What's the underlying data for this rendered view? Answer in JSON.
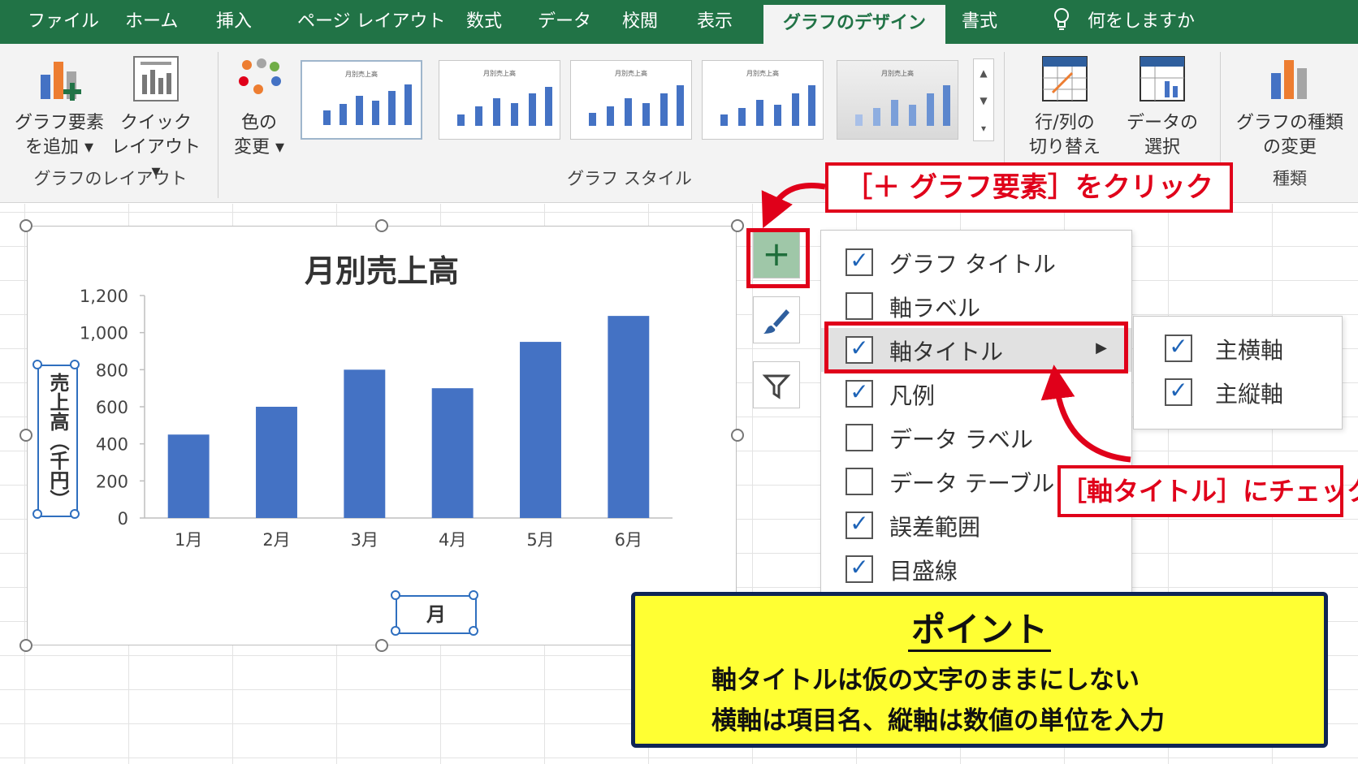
{
  "tabs": [
    {
      "label": "ファイル"
    },
    {
      "label": "ホーム"
    },
    {
      "label": "挿入"
    },
    {
      "label": "ページ レイアウト"
    },
    {
      "label": "数式"
    },
    {
      "label": "データ"
    },
    {
      "label": "校閲"
    },
    {
      "label": "表示"
    },
    {
      "label": "グラフのデザイン"
    },
    {
      "label": "書式"
    }
  ],
  "tell_me": "何をしますか",
  "ribbon": {
    "add_element": {
      "line1": "グラフ要素",
      "line2": "を追加 ▾"
    },
    "quick_layout": {
      "line1": "クイック",
      "line2": "レイアウト ▾"
    },
    "layout_group": "グラフのレイアウト",
    "change_colors": {
      "line1": "色の",
      "line2": "変更 ▾"
    },
    "style_group": "グラフ スタイル",
    "thumb_title": "月別売上高",
    "switch_rowcol": {
      "line1": "行/列の",
      "line2": "切り替え"
    },
    "select_data": {
      "line1": "データの",
      "line2": "選択"
    },
    "change_type": {
      "line1": "グラフの種類",
      "line2": "の変更"
    },
    "type_group": "種類",
    "colors": {
      "accent": "#217346",
      "bar": "#4472c4",
      "highlight": "#e0001a"
    }
  },
  "chart_data": {
    "type": "bar",
    "title": "月別売上高",
    "categories": [
      "1月",
      "2月",
      "3月",
      "4月",
      "5月",
      "6月"
    ],
    "values": [
      450,
      600,
      800,
      700,
      950,
      1090
    ],
    "ylim": [
      0,
      1200
    ],
    "yticks": [
      "0",
      "200",
      "400",
      "600",
      "800",
      "1,000",
      "1,200"
    ],
    "ytick_values": [
      0,
      200,
      400,
      600,
      800,
      1000,
      1200
    ],
    "xlabel": "月",
    "ylabel": "売上高（千円）",
    "grid": false,
    "legend": false,
    "bar_color": "#4472c4"
  },
  "chart_elements_menu": {
    "items": [
      {
        "label": "グラフ タイトル",
        "checked": "✓"
      },
      {
        "label": "軸ラベル",
        "checked": ""
      },
      {
        "label": "軸タイトル",
        "checked": "✓"
      },
      {
        "label": "凡例",
        "checked": "✓"
      },
      {
        "label": "データ ラベル",
        "checked": ""
      },
      {
        "label": "データ テーブル",
        "checked": ""
      },
      {
        "label": "誤差範囲",
        "checked": "✓"
      },
      {
        "label": "目盛線",
        "checked": "✓"
      }
    ],
    "submenu": [
      {
        "label": "主横軸",
        "checked": "✓"
      },
      {
        "label": "主縦軸",
        "checked": "✓"
      }
    ]
  },
  "callouts": {
    "click_plus": "［＋ グラフ要素］をクリック",
    "check_axis": "［軸タイトル］にチェック"
  },
  "point": {
    "title": "ポイント",
    "line1": "軸タイトルは仮の文字のままにしない",
    "line2": "横軸は項目名、縦軸は数値の単位を入力"
  }
}
